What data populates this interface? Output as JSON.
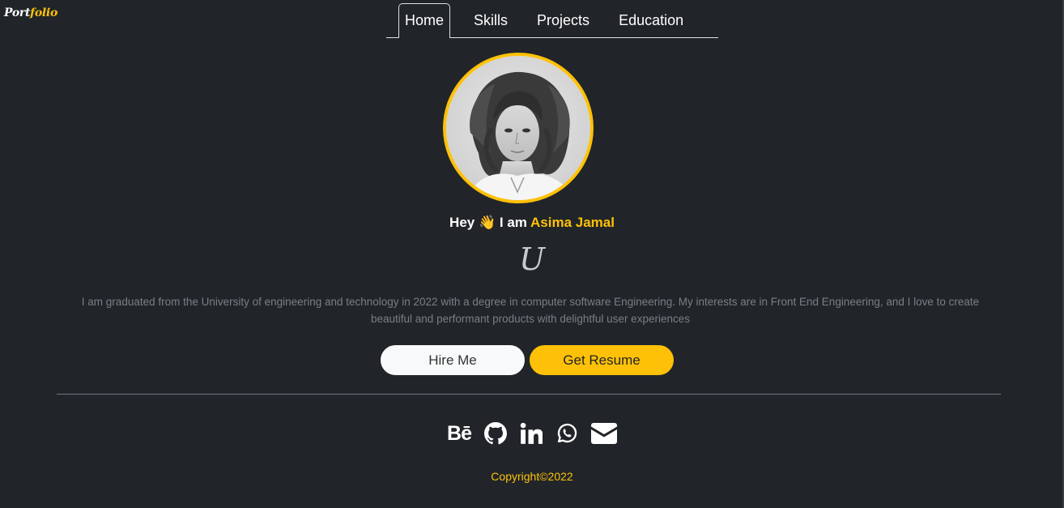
{
  "brand": {
    "part1": "Port",
    "part2": "folio"
  },
  "nav": {
    "items": [
      {
        "label": "Home",
        "active": true
      },
      {
        "label": "Skills",
        "active": false
      },
      {
        "label": "Projects",
        "active": false
      },
      {
        "label": "Education",
        "active": false
      }
    ]
  },
  "hero": {
    "avatar_icon": "portrait-avatar",
    "greeting_prefix": "Hey",
    "wave_emoji": "👋",
    "greeting_mid": "I am",
    "name": "Asima Jamal",
    "typed_text": "U",
    "bio": "I am graduated from the University of engineering and technology in 2022 with a degree in computer software Engineering. My interests are in Front End Engineering, and I love to create beautiful and performant products with delightful user experiences"
  },
  "buttons": {
    "hire": "Hire Me",
    "resume": "Get Resume"
  },
  "socials": [
    {
      "name": "behance-icon",
      "glyph": "Bē"
    },
    {
      "name": "github-icon"
    },
    {
      "name": "linkedin-icon"
    },
    {
      "name": "whatsapp-icon"
    },
    {
      "name": "email-icon"
    }
  ],
  "footer": {
    "copyright": "Copyright©2022"
  },
  "colors": {
    "background": "#212529",
    "accent": "#ffc107",
    "text": "#ffffff"
  }
}
